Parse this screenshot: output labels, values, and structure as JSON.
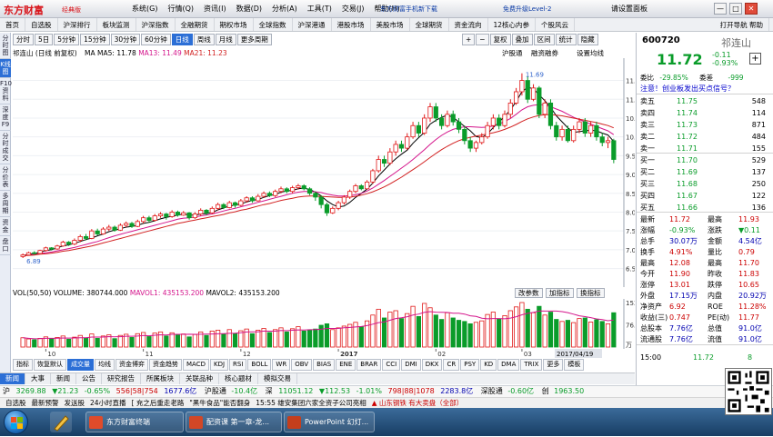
{
  "app": {
    "logo": "东方财富",
    "logo_sub": "经典版",
    "menu": [
      "系统(G)",
      "行情(Q)",
      "资讯(I)",
      "数据(D)",
      "分析(A)",
      "工具(T)",
      "交易(J)",
      "帮助(H)"
    ],
    "promo": "东方财富手机新下载",
    "promo2": "免费升级Level-2",
    "login": "请设置面板",
    "win_min": "—",
    "win_max": "□",
    "win_close": "✕"
  },
  "nav": {
    "items": [
      "首页",
      "自选股",
      "沪深排行",
      "板块监测",
      "沪深指数",
      "全融期货",
      "期权市场",
      "全球指数",
      "沪深港通",
      "港股市场",
      "美股市场",
      "全球期货",
      "资金流向",
      "12核心内参",
      "个股风云"
    ],
    "right": "打开导航  帮助"
  },
  "left_tabs": [
    "分时图",
    "K线图",
    "F10资料",
    "深度F9",
    "分时成交",
    "分价表",
    "多周期",
    "资金",
    "盘口"
  ],
  "period": {
    "buttons": [
      "分时",
      "5日",
      "5分钟",
      "15分钟",
      "30分钟",
      "60分钟",
      "日线",
      "周线",
      "月线",
      "更多周期"
    ],
    "active": "日线",
    "tools": [
      "+",
      "−",
      "复权",
      "叠加",
      "区间",
      "统计",
      "隐藏"
    ],
    "labels": [
      "沪股通",
      "融资融券",
      "设置均线"
    ]
  },
  "stock_head": {
    "name": "祁连山",
    "adj": "(日线 前复权)",
    "ma_label": "MA",
    "ma5": "MA5: 11.78",
    "ma13": "MA13: 11.49",
    "ma21": "MA21: 11.23",
    "ma5_color": "#000000",
    "ma13_color": "#d4148b",
    "ma21_color": "#d22020"
  },
  "volume_head": {
    "title": "VOL(50,50)",
    "volume": "VOLUME: 380744.000",
    "mavol1": "MAVOL1: 435153.200",
    "mavol2": "MAVOL2: 435153.200",
    "params": "改参数",
    "add": "加指标",
    "change": "换指标"
  },
  "chart_data": {
    "type": "candlestick",
    "y_axis_ticks": [
      "11.50",
      "11.00",
      "10.50",
      "10.00",
      "9.50",
      "9.00",
      "8.50",
      "8.00",
      "7.50",
      "7.00",
      "6.50"
    ],
    "ylim": [
      6.2,
      11.9
    ],
    "month_labels": [
      "10",
      "11",
      "12",
      "2017",
      "02",
      "03"
    ],
    "high_label": "11.69",
    "low_label": "6.89",
    "date_highlight": "2017/04/19",
    "vol_ticks": [
      "153.00",
      "76.40",
      "万"
    ],
    "vol_max": 153.0,
    "candles": [
      [
        6.82,
        6.86,
        6.78,
        6.9
      ],
      [
        6.86,
        6.92,
        6.84,
        6.95
      ],
      [
        6.92,
        6.9,
        6.87,
        6.96
      ],
      [
        6.9,
        6.98,
        6.88,
        7.0
      ],
      [
        6.98,
        7.05,
        6.95,
        7.08
      ],
      [
        7.05,
        7.02,
        6.98,
        7.07
      ],
      [
        7.02,
        7.1,
        7.0,
        7.13
      ],
      [
        7.1,
        7.2,
        7.08,
        7.24
      ],
      [
        7.2,
        7.15,
        7.1,
        7.23
      ],
      [
        7.15,
        7.25,
        7.12,
        7.3
      ],
      [
        7.25,
        7.35,
        7.2,
        7.4
      ],
      [
        7.35,
        7.3,
        7.25,
        7.42
      ],
      [
        7.3,
        7.5,
        7.28,
        7.55
      ],
      [
        7.5,
        7.42,
        7.38,
        7.56
      ],
      [
        7.42,
        7.55,
        7.4,
        7.6
      ],
      [
        7.55,
        7.6,
        7.5,
        7.66
      ],
      [
        7.6,
        7.52,
        7.48,
        7.64
      ],
      [
        7.52,
        7.65,
        7.5,
        7.7
      ],
      [
        7.65,
        7.7,
        7.6,
        7.75
      ],
      [
        7.7,
        7.62,
        7.58,
        7.74
      ],
      [
        7.62,
        7.75,
        7.6,
        7.8
      ],
      [
        7.75,
        7.85,
        7.7,
        7.9
      ],
      [
        7.85,
        7.78,
        7.72,
        7.9
      ],
      [
        7.78,
        7.9,
        7.75,
        7.95
      ],
      [
        7.9,
        7.95,
        7.85,
        8.0
      ],
      [
        7.95,
        7.88,
        7.8,
        7.98
      ],
      [
        7.88,
        8.0,
        7.85,
        8.05
      ],
      [
        8.0,
        7.92,
        7.88,
        8.04
      ],
      [
        7.92,
        7.98,
        7.9,
        8.03
      ],
      [
        7.98,
        7.85,
        7.8,
        8.0
      ],
      [
        7.85,
        7.95,
        7.82,
        8.0
      ],
      [
        7.95,
        8.05,
        7.9,
        8.1
      ],
      [
        8.05,
        7.98,
        7.92,
        8.08
      ],
      [
        7.98,
        8.1,
        7.95,
        8.15
      ],
      [
        8.1,
        8.2,
        8.05,
        8.25
      ],
      [
        8.2,
        8.12,
        8.08,
        8.24
      ],
      [
        8.12,
        8.25,
        8.1,
        8.3
      ],
      [
        8.25,
        8.18,
        8.12,
        8.28
      ],
      [
        8.18,
        8.3,
        8.15,
        8.35
      ],
      [
        8.3,
        8.38,
        8.25,
        8.42
      ],
      [
        8.38,
        8.3,
        8.25,
        8.42
      ],
      [
        8.3,
        8.42,
        8.28,
        8.48
      ],
      [
        8.42,
        8.5,
        8.38,
        8.55
      ],
      [
        8.5,
        8.44,
        8.4,
        8.55
      ],
      [
        8.44,
        8.55,
        8.4,
        8.6
      ],
      [
        8.55,
        8.62,
        8.5,
        8.68
      ],
      [
        8.62,
        8.55,
        8.5,
        8.66
      ],
      [
        8.55,
        8.65,
        8.5,
        8.7
      ],
      [
        8.65,
        8.7,
        8.6,
        8.75
      ],
      [
        8.7,
        8.62,
        8.58,
        8.74
      ],
      [
        8.62,
        8.5,
        8.45,
        8.66
      ],
      [
        8.5,
        8.4,
        8.3,
        8.55
      ],
      [
        8.4,
        8.2,
        8.1,
        8.45
      ],
      [
        8.2,
        7.98,
        7.9,
        8.25
      ],
      [
        7.98,
        8.1,
        7.95,
        8.15
      ],
      [
        8.1,
        8.25,
        8.05,
        8.3
      ],
      [
        8.25,
        8.4,
        8.2,
        8.45
      ],
      [
        8.4,
        8.55,
        8.35,
        8.6
      ],
      [
        8.55,
        8.7,
        8.5,
        8.75
      ],
      [
        8.7,
        8.62,
        8.58,
        8.74
      ],
      [
        8.62,
        8.8,
        8.6,
        8.85
      ],
      [
        8.8,
        9.1,
        8.75,
        9.15
      ],
      [
        9.1,
        9.4,
        9.05,
        9.5
      ],
      [
        9.4,
        9.3,
        9.2,
        9.5
      ],
      [
        9.3,
        9.6,
        9.25,
        9.7
      ],
      [
        9.6,
        9.8,
        9.5,
        9.9
      ],
      [
        9.8,
        9.7,
        9.6,
        9.9
      ],
      [
        9.7,
        10.0,
        9.65,
        10.1
      ],
      [
        10.0,
        10.3,
        9.95,
        10.4
      ],
      [
        10.3,
        10.1,
        10.0,
        10.4
      ],
      [
        10.1,
        10.5,
        10.05,
        10.6
      ],
      [
        10.5,
        10.8,
        10.4,
        10.9
      ],
      [
        10.8,
        10.5,
        10.4,
        10.9
      ],
      [
        10.5,
        10.3,
        10.2,
        10.6
      ],
      [
        10.3,
        10.6,
        10.25,
        10.7
      ],
      [
        10.6,
        10.4,
        10.3,
        10.7
      ],
      [
        10.4,
        10.2,
        10.1,
        10.5
      ],
      [
        10.2,
        9.9,
        9.8,
        10.3
      ],
      [
        9.9,
        9.7,
        9.6,
        10.0
      ],
      [
        9.7,
        9.85,
        9.6,
        9.9
      ],
      [
        9.85,
        10.0,
        9.8,
        10.1
      ],
      [
        10.0,
        10.3,
        9.95,
        10.4
      ],
      [
        10.3,
        10.5,
        10.2,
        10.6
      ],
      [
        10.5,
        10.3,
        10.2,
        10.6
      ],
      [
        10.3,
        10.6,
        10.25,
        10.7
      ],
      [
        10.6,
        10.9,
        10.5,
        11.0
      ],
      [
        10.9,
        11.2,
        10.85,
        11.3
      ],
      [
        11.2,
        11.5,
        11.1,
        11.69
      ],
      [
        11.5,
        11.0,
        10.9,
        11.6
      ],
      [
        11.0,
        11.3,
        10.95,
        11.4
      ],
      [
        11.3,
        10.6,
        10.5,
        11.35
      ],
      [
        10.6,
        10.9,
        10.5,
        11.0
      ],
      [
        10.9,
        10.3,
        10.2,
        11.0
      ],
      [
        10.3,
        10.0,
        9.9,
        10.4
      ],
      [
        10.0,
        10.2,
        9.9,
        10.3
      ],
      [
        10.2,
        9.9,
        9.85,
        10.3
      ],
      [
        9.9,
        10.2,
        9.85,
        10.3
      ],
      [
        10.2,
        10.4,
        10.1,
        10.5
      ],
      [
        10.4,
        10.1,
        10.0,
        10.5
      ],
      [
        10.1,
        10.3,
        10.0,
        10.4
      ],
      [
        10.3,
        10.0,
        9.9,
        10.4
      ],
      [
        10.0,
        9.85,
        9.75,
        10.1
      ],
      [
        9.85,
        9.9,
        9.7,
        10.0
      ],
      [
        9.9,
        9.4,
        9.3,
        9.95
      ]
    ],
    "volumes": [
      32,
      28,
      25,
      30,
      35,
      29,
      33,
      38,
      27,
      34,
      40,
      31,
      45,
      30,
      38,
      42,
      29,
      40,
      44,
      33,
      46,
      50,
      36,
      48,
      52,
      38,
      49,
      41,
      45,
      35,
      43,
      52,
      40,
      55,
      58,
      44,
      60,
      47,
      56,
      62,
      46,
      58,
      64,
      50,
      60,
      66,
      52,
      63,
      70,
      55,
      58,
      62,
      75,
      80,
      60,
      66,
      72,
      78,
      85,
      70,
      90,
      110,
      130,
      100,
      120,
      125,
      98,
      115,
      140,
      105,
      150,
      135,
      110,
      95,
      118,
      100,
      92,
      88,
      80,
      85,
      90,
      112,
      120,
      96,
      108,
      125,
      138,
      153,
      130,
      118,
      140,
      110,
      120,
      95,
      88,
      92,
      84,
      98,
      100,
      86,
      94,
      88,
      80,
      118
    ],
    "ma5": [
      6.84,
      6.88,
      6.9,
      6.93,
      6.98,
      7.0,
      7.05,
      7.1,
      7.13,
      7.17,
      7.22,
      7.27,
      7.31,
      7.37,
      7.42,
      7.48,
      7.52,
      7.56,
      7.6,
      7.62,
      7.65,
      7.7,
      7.73,
      7.77,
      7.82,
      7.86,
      7.89,
      7.92,
      7.95,
      7.92,
      7.92,
      7.95,
      7.96,
      7.99,
      8.06,
      8.11,
      8.16,
      8.19,
      8.22,
      8.27,
      8.31,
      8.34,
      8.39,
      8.44,
      8.47,
      8.53,
      8.56,
      8.58,
      8.62,
      8.64,
      8.6,
      8.53,
      8.43,
      8.3,
      8.2,
      8.14,
      8.16,
      8.26,
      8.39,
      8.5,
      8.61,
      8.77,
      8.96,
      9.12,
      9.28,
      9.42,
      9.54,
      9.65,
      9.83,
      9.98,
      10.12,
      10.34,
      10.44,
      10.52,
      10.58,
      10.52,
      10.4,
      10.28,
      10.16,
      10.01,
      9.98,
      10.08,
      10.25,
      10.39,
      10.55,
      10.72,
      10.94,
      11.2,
      11.32,
      11.28,
      11.12,
      10.96,
      10.78,
      10.56,
      10.4,
      10.24,
      10.12,
      10.14,
      10.16,
      10.18,
      10.16,
      10.1,
      10.05,
      9.88
    ],
    "ma13": [
      6.84,
      6.86,
      6.88,
      6.9,
      6.92,
      6.94,
      6.97,
      7.0,
      7.03,
      7.06,
      7.1,
      7.14,
      7.18,
      7.22,
      7.27,
      7.32,
      7.37,
      7.41,
      7.45,
      7.49,
      7.53,
      7.57,
      7.61,
      7.65,
      7.69,
      7.73,
      7.77,
      7.81,
      7.84,
      7.85,
      7.87,
      7.9,
      7.92,
      7.95,
      7.99,
      8.03,
      8.07,
      8.1,
      8.14,
      8.18,
      8.22,
      8.26,
      8.3,
      8.34,
      8.38,
      8.42,
      8.46,
      8.5,
      8.53,
      8.55,
      8.55,
      8.54,
      8.52,
      8.48,
      8.45,
      8.43,
      8.43,
      8.44,
      8.46,
      8.5,
      8.56,
      8.64,
      8.74,
      8.84,
      8.95,
      9.06,
      9.17,
      9.28,
      9.4,
      9.53,
      9.66,
      9.8,
      9.93,
      10.04,
      10.13,
      10.2,
      10.24,
      10.27,
      10.27,
      10.26,
      10.25,
      10.26,
      10.29,
      10.34,
      10.41,
      10.49,
      10.6,
      10.72,
      10.8,
      10.84,
      10.86,
      10.85,
      10.8,
      10.74,
      10.68,
      10.6,
      10.52,
      10.46,
      10.4,
      10.34,
      10.28,
      10.22,
      10.16,
      10.06
    ],
    "ma21": [
      6.84,
      6.85,
      6.86,
      6.88,
      6.89,
      6.91,
      6.93,
      6.96,
      6.98,
      7.01,
      7.04,
      7.07,
      7.1,
      7.14,
      7.18,
      7.22,
      7.26,
      7.3,
      7.34,
      7.38,
      7.42,
      7.46,
      7.5,
      7.54,
      7.58,
      7.62,
      7.66,
      7.7,
      7.73,
      7.76,
      7.79,
      7.82,
      7.85,
      7.88,
      7.91,
      7.94,
      7.98,
      8.01,
      8.05,
      8.08,
      8.12,
      8.16,
      8.2,
      8.23,
      8.27,
      8.31,
      8.34,
      8.37,
      8.4,
      8.42,
      8.43,
      8.43,
      8.42,
      8.41,
      8.4,
      8.39,
      8.39,
      8.4,
      8.42,
      8.45,
      8.49,
      8.54,
      8.6,
      8.67,
      8.75,
      8.84,
      8.93,
      9.03,
      9.13,
      9.23,
      9.34,
      9.45,
      9.56,
      9.66,
      9.75,
      9.83,
      9.9,
      9.95,
      9.99,
      10.02,
      10.05,
      10.08,
      10.11,
      10.15,
      10.2,
      10.26,
      10.33,
      10.41,
      10.48,
      10.53,
      10.57,
      10.59,
      10.59,
      10.58,
      10.56,
      10.53,
      10.5,
      10.47,
      10.44,
      10.41,
      10.38,
      10.34,
      10.3,
      10.24
    ]
  },
  "indicators": {
    "items": [
      "指标",
      "恢复默认",
      "成交量",
      "均线",
      "资金博弈",
      "资金趋势",
      "MACD",
      "KDJ",
      "RSI",
      "BOLL",
      "WR",
      "OBV",
      "BIAS",
      "ENE",
      "BRAR",
      "CCI",
      "DMI",
      "DKX",
      "CR",
      "PSY",
      "KD",
      "DMA",
      "TRIX",
      "更多",
      "模板"
    ],
    "active": "成交量"
  },
  "news_tabs": {
    "items": [
      "新闻",
      "大事",
      "新闻",
      "公告",
      "研究报告",
      "所属板块",
      "关联品种",
      "核心题材",
      "模拟交易"
    ],
    "active": "新闻"
  },
  "side": {
    "code": "600720",
    "name": "祁连山",
    "price": "11.72",
    "change": "-0.11",
    "change_pct": "-0.93%",
    "weibi_label": "委比",
    "weibi": "-29.85%",
    "weicha_label": "委差",
    "weicha": "-999",
    "warn_link": "注意！创业板发出买点信号？",
    "asks": [
      {
        "label": "卖五",
        "price": "11.75",
        "vol": "548"
      },
      {
        "label": "卖四",
        "price": "11.74",
        "vol": "114"
      },
      {
        "label": "卖三",
        "price": "11.73",
        "vol": "871"
      },
      {
        "label": "卖二",
        "price": "11.72",
        "vol": "484"
      },
      {
        "label": "卖一",
        "price": "11.71",
        "vol": "155"
      }
    ],
    "bids": [
      {
        "label": "买一",
        "price": "11.70",
        "vol": "529"
      },
      {
        "label": "买二",
        "price": "11.69",
        "vol": "137"
      },
      {
        "label": "买三",
        "price": "11.68",
        "vol": "250"
      },
      {
        "label": "买四",
        "price": "11.67",
        "vol": "122"
      },
      {
        "label": "买五",
        "price": "11.66",
        "vol": "136"
      }
    ],
    "stats": [
      [
        "最新",
        "11.72",
        "最高",
        "11.93"
      ],
      [
        "涨幅",
        "-0.93%",
        "涨跌",
        "▼0.11"
      ],
      [
        "总手",
        "30.07万",
        "金额",
        "4.54亿"
      ],
      [
        "换手",
        "4.91%",
        "量比",
        "0.79"
      ],
      [
        "最高",
        "12.08",
        "最高",
        "11.70"
      ],
      [
        "今开",
        "11.90",
        "昨收",
        "11.83"
      ],
      [
        "涨停",
        "13.01",
        "跌停",
        "10.65"
      ],
      [
        "外盘",
        "17.15万",
        "内盘",
        "20.92万"
      ],
      [
        "净资产",
        "6.92",
        "ROE",
        "11.28%"
      ],
      [
        "收益(三)",
        "0.747",
        "PE(动)",
        "11.77"
      ],
      [
        "总股本",
        "7.76亿",
        "总值",
        "91.0亿"
      ],
      [
        "流通股",
        "7.76亿",
        "流值",
        "91.0亿"
      ]
    ],
    "trade_time": "15:00",
    "trade_price": "11.72",
    "trade_vol": "8"
  },
  "index_row": {
    "sh_label": "沪",
    "sh_val": "3269.88",
    "sh_chg": "▼21.23",
    "sh_pct": "-0.65%",
    "sh_amt": "556|58|754",
    "sh_turnover": "1677.6亿",
    "hs_label": "沪股通",
    "hs_val": "-10.4亿",
    "sz_label": "深",
    "sz_val": "11051.12",
    "sz_chg": "▼112.53",
    "sz_pct": "-1.01%",
    "sz_amt": "798|88|1078",
    "sz_turnover": "2283.8亿",
    "sgt_label": "深股通",
    "sgt_val": "-0.60亿",
    "cy_label": "创",
    "cy_val": "1963.50"
  },
  "ticker": {
    "items": [
      "自选股",
      "最新预警",
      "发送股",
      "24小时直播",
      "[ 充之后重走老路",
      "\"黑牛食品\"能否翻身",
      "15:55 雄安集团六家全资子公司亮相",
      "▲ 山东钢铁 有大卖盘（全部）"
    ]
  },
  "taskbar": {
    "items": [
      "东方财富终端",
      "配资课 第一章-龙...",
      "PowerPoint 幻灯..."
    ]
  }
}
